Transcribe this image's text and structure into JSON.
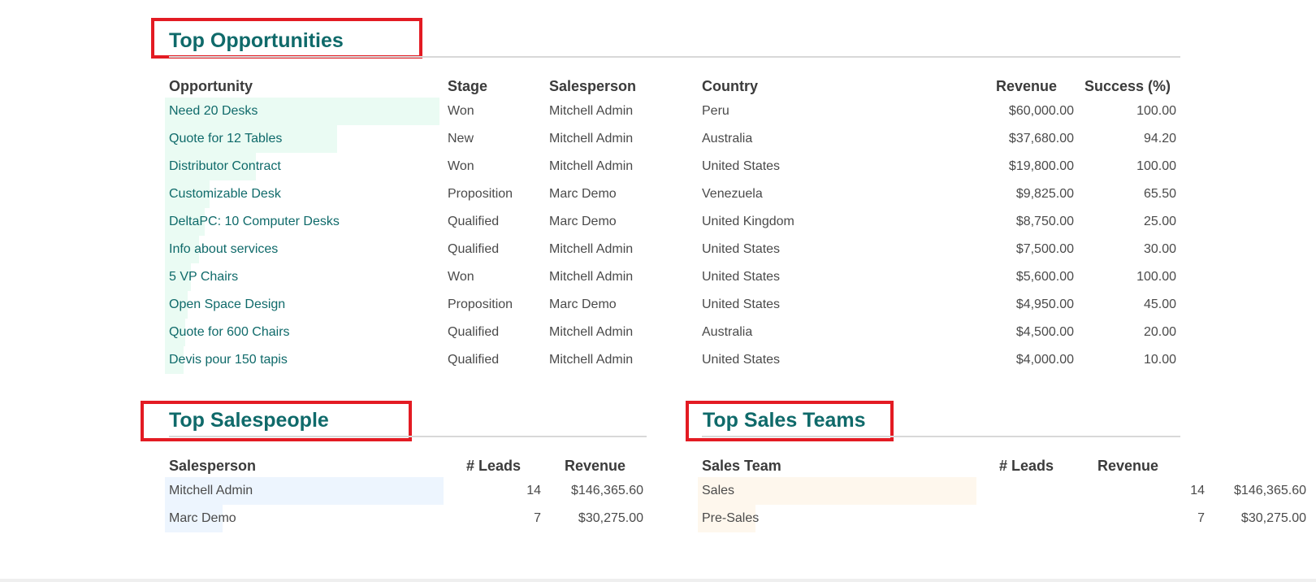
{
  "top_opportunities": {
    "title": "Top Opportunities",
    "headers": {
      "opportunity": "Opportunity",
      "stage": "Stage",
      "salesperson": "Salesperson",
      "country": "Country",
      "revenue": "Revenue",
      "success": "Success (%)"
    },
    "bar_color": "#eafbf3",
    "rows": [
      {
        "name": "Need 20 Desks",
        "stage": "Won",
        "salesperson": "Mitchell Admin",
        "country": "Peru",
        "revenue": "$60,000.00",
        "success": "100.00",
        "revenue_value": 60000
      },
      {
        "name": "Quote for 12 Tables",
        "stage": "New",
        "salesperson": "Mitchell Admin",
        "country": "Australia",
        "revenue": "$37,680.00",
        "success": "94.20",
        "revenue_value": 37680
      },
      {
        "name": "Distributor Contract",
        "stage": "Won",
        "salesperson": "Mitchell Admin",
        "country": "United States",
        "revenue": "$19,800.00",
        "success": "100.00",
        "revenue_value": 19800
      },
      {
        "name": "Customizable Desk",
        "stage": "Proposition",
        "salesperson": "Marc Demo",
        "country": "Venezuela",
        "revenue": "$9,825.00",
        "success": "65.50",
        "revenue_value": 9825
      },
      {
        "name": "DeltaPC: 10 Computer Desks",
        "stage": "Qualified",
        "salesperson": "Marc Demo",
        "country": "United Kingdom",
        "revenue": "$8,750.00",
        "success": "25.00",
        "revenue_value": 8750
      },
      {
        "name": "Info about services",
        "stage": "Qualified",
        "salesperson": "Mitchell Admin",
        "country": "United States",
        "revenue": "$7,500.00",
        "success": "30.00",
        "revenue_value": 7500
      },
      {
        "name": "5 VP Chairs",
        "stage": "Won",
        "salesperson": "Mitchell Admin",
        "country": "United States",
        "revenue": "$5,600.00",
        "success": "100.00",
        "revenue_value": 5600
      },
      {
        "name": "Open Space Design",
        "stage": "Proposition",
        "salesperson": "Marc Demo",
        "country": "United States",
        "revenue": "$4,950.00",
        "success": "45.00",
        "revenue_value": 4950
      },
      {
        "name": "Quote for 600 Chairs",
        "stage": "Qualified",
        "salesperson": "Mitchell Admin",
        "country": "Australia",
        "revenue": "$4,500.00",
        "success": "20.00",
        "revenue_value": 4500
      },
      {
        "name": "Devis pour 150 tapis",
        "stage": "Qualified",
        "salesperson": "Mitchell Admin",
        "country": "United States",
        "revenue": "$4,000.00",
        "success": "10.00",
        "revenue_value": 4000
      }
    ]
  },
  "top_salespeople": {
    "title": "Top Salespeople",
    "headers": {
      "salesperson": "Salesperson",
      "leads": "# Leads",
      "revenue": "Revenue"
    },
    "bar_color": "#edf5fe",
    "rows": [
      {
        "name": "Mitchell Admin",
        "leads": "14",
        "revenue": "$146,365.60",
        "revenue_value": 146365.6
      },
      {
        "name": "Marc Demo",
        "leads": "7",
        "revenue": "$30,275.00",
        "revenue_value": 30275
      }
    ]
  },
  "top_sales_teams": {
    "title": "Top Sales Teams",
    "headers": {
      "team": "Sales Team",
      "leads": "# Leads",
      "revenue": "Revenue"
    },
    "bar_color": "#fef7ed",
    "rows": [
      {
        "name": "Sales",
        "leads": "14",
        "revenue": "$146,365.60",
        "revenue_value": 146365.6
      },
      {
        "name": "Pre-Sales",
        "leads": "7",
        "revenue": "$30,275.00",
        "revenue_value": 30275
      }
    ]
  },
  "heading_color": "#0f6a6a",
  "highlight_box_color": "#e31b23"
}
